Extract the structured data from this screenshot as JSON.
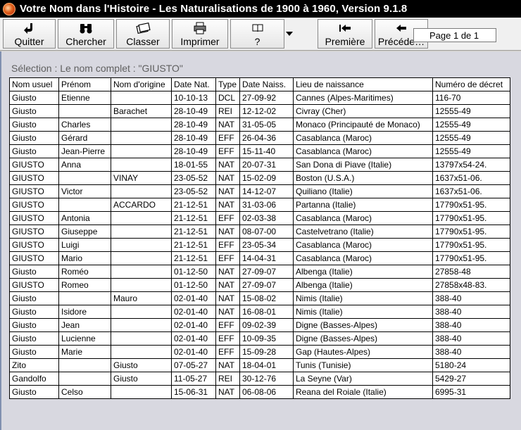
{
  "window": {
    "title": "Votre Nom dans l'Histoire - Les Naturalisations de 1900 à 1960, Version 9.1.8"
  },
  "toolbar": {
    "quit_label": "Quitter",
    "search_label": "Chercher",
    "sort_label": "Classer",
    "print_label": "Imprimer",
    "help_label": "?",
    "first_label": "Première",
    "prev_label": "Précéde…",
    "page_indicator": "Page 1 de 1"
  },
  "selection": {
    "text": "Sélection : Le nom complet : \"GIUSTO\""
  },
  "table": {
    "columns": [
      "Nom usuel",
      "Prénom",
      "Nom d'origine",
      "Date Nat.",
      "Type",
      "Date Naiss.",
      "Lieu de naissance",
      "Numéro de décret"
    ],
    "rows": [
      [
        "Giusto",
        "Etienne",
        "",
        "10-10-13",
        "DCL",
        "27-09-92",
        "Cannes (Alpes-Maritimes)",
        "116-70"
      ],
      [
        "Giusto",
        "",
        "Barachet",
        "28-10-49",
        "REI",
        "12-12-02",
        "Civray (Cher)",
        "12555-49"
      ],
      [
        "Giusto",
        "Charles",
        "",
        "28-10-49",
        "NAT",
        "31-05-05",
        "Monaco (Principauté de Monaco)",
        "12555-49"
      ],
      [
        "Giusto",
        "Gérard",
        "",
        "28-10-49",
        "EFF",
        "26-04-36",
        "Casablanca (Maroc)",
        "12555-49"
      ],
      [
        "Giusto",
        "Jean-Pierre",
        "",
        "28-10-49",
        "EFF",
        "15-11-40",
        "Casablanca (Maroc)",
        "12555-49"
      ],
      [
        "GIUSTO",
        "Anna",
        "",
        "18-01-55",
        "NAT",
        "20-07-31",
        "San Dona di Piave (Italie)",
        "13797x54-24."
      ],
      [
        "GIUSTO",
        "",
        "VINAY",
        "23-05-52",
        "NAT",
        "15-02-09",
        "Boston (U.S.A.)",
        "1637x51-06."
      ],
      [
        "GIUSTO",
        "Victor",
        "",
        "23-05-52",
        "NAT",
        "14-12-07",
        "Quiliano (Italie)",
        "1637x51-06."
      ],
      [
        "GIUSTO",
        "",
        "ACCARDO",
        "21-12-51",
        "NAT",
        "31-03-06",
        "Partanna (Italie)",
        "17790x51-95."
      ],
      [
        "GIUSTO",
        "Antonia",
        "",
        "21-12-51",
        "EFF",
        "02-03-38",
        "Casablanca (Maroc)",
        "17790x51-95."
      ],
      [
        "GIUSTO",
        "Giuseppe",
        "",
        "21-12-51",
        "NAT",
        "08-07-00",
        "Castelvetrano (Italie)",
        "17790x51-95."
      ],
      [
        "GIUSTO",
        "Luigi",
        "",
        "21-12-51",
        "EFF",
        "23-05-34",
        "Casablanca (Maroc)",
        "17790x51-95."
      ],
      [
        "GIUSTO",
        "Mario",
        "",
        "21-12-51",
        "EFF",
        "14-04-31",
        "Casablanca (Maroc)",
        "17790x51-95."
      ],
      [
        "Giusto",
        "Roméo",
        "",
        "01-12-50",
        "NAT",
        "27-09-07",
        "Albenga (Italie)",
        "27858-48"
      ],
      [
        "GIUSTO",
        "Romeo",
        "",
        "01-12-50",
        "NAT",
        "27-09-07",
        "Albenga (Italie)",
        "27858x48-83."
      ],
      [
        "Giusto",
        "",
        "Mauro",
        "02-01-40",
        "NAT",
        "15-08-02",
        "Nimis (Italie)",
        "388-40"
      ],
      [
        "Giusto",
        "Isidore",
        "",
        "02-01-40",
        "NAT",
        "16-08-01",
        "Nimis (Italie)",
        "388-40"
      ],
      [
        "Giusto",
        "Jean",
        "",
        "02-01-40",
        "EFF",
        "09-02-39",
        "Digne (Basses-Alpes)",
        "388-40"
      ],
      [
        "Giusto",
        "Lucienne",
        "",
        "02-01-40",
        "EFF",
        "10-09-35",
        "Digne (Basses-Alpes)",
        "388-40"
      ],
      [
        "Giusto",
        "Marie",
        "",
        "02-01-40",
        "EFF",
        "15-09-28",
        "Gap (Hautes-Alpes)",
        "388-40"
      ],
      [
        "Zito",
        "",
        "Giusto",
        "07-05-27",
        "NAT",
        "18-04-01",
        "Tunis (Tunisie)",
        "5180-24"
      ],
      [
        "Gandolfo",
        "",
        "Giusto",
        "11-05-27",
        "REI",
        "30-12-76",
        "La Seyne (Var)",
        "5429-27"
      ],
      [
        "Giusto",
        "Celso",
        "",
        "15-06-31",
        "NAT",
        "06-08-06",
        "Reana del Roiale (Italie)",
        "6995-31"
      ]
    ]
  }
}
